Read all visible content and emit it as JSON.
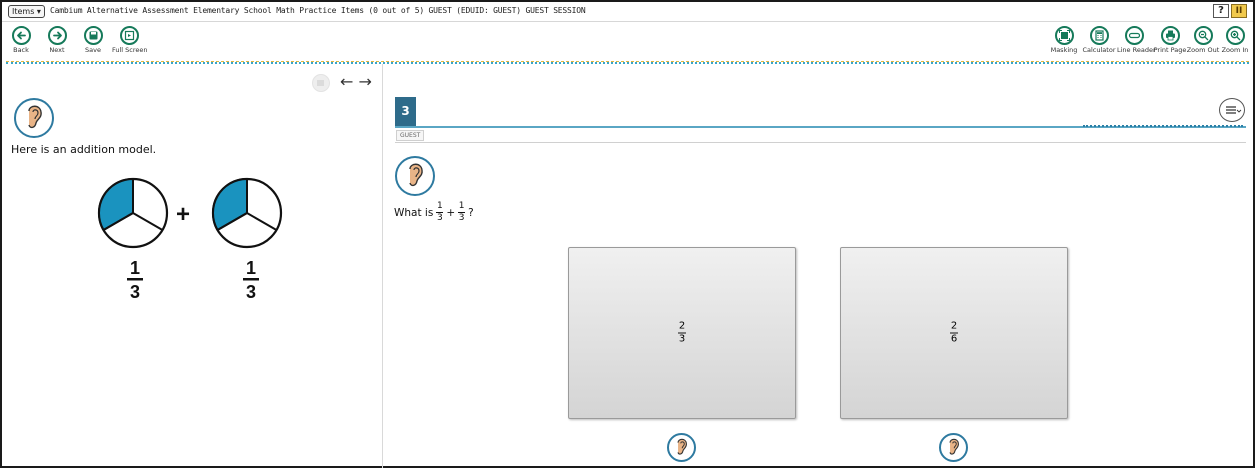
{
  "header": {
    "items_label": "Items ▾",
    "title": "Cambium Alternative Assessment Elementary School Math Practice Items (0 out of 5)   GUEST (EDUID: GUEST)   GUEST SESSION",
    "help_label": "?",
    "pause_label": "II"
  },
  "toolbar": {
    "left_tools": [
      {
        "label": "Back",
        "icon": "arrow-left-icon"
      },
      {
        "label": "Next",
        "icon": "arrow-right-icon"
      },
      {
        "label": "Save",
        "icon": "save-icon"
      },
      {
        "label": "Full Screen",
        "icon": "fullscreen-icon"
      }
    ],
    "right_tools": [
      {
        "label": "Masking",
        "icon": "masking-icon"
      },
      {
        "label": "Calculator",
        "icon": "calculator-icon"
      },
      {
        "label": "Line Reader",
        "icon": "line-reader-icon"
      },
      {
        "label": "Print Page",
        "icon": "print-icon"
      },
      {
        "label": "Zoom Out",
        "icon": "zoom-out-icon"
      },
      {
        "label": "Zoom In",
        "icon": "zoom-in-icon"
      }
    ],
    "accent_color": "#167a5a"
  },
  "stimulus": {
    "nav_arrows": "← →",
    "intro": "Here is an addition model.",
    "plus_sign": "+",
    "left_fraction": {
      "numerator": "1",
      "denominator": "3"
    },
    "right_fraction": {
      "numerator": "1",
      "denominator": "3"
    },
    "shaded_fraction": 0.3333,
    "shade_color": "#1a93bf"
  },
  "question": {
    "number": "3",
    "guest_tag": "GUEST",
    "prefix": "What is",
    "a": {
      "numerator": "1",
      "denominator": "3"
    },
    "operator": "+",
    "b": {
      "numerator": "1",
      "denominator": "3"
    },
    "suffix": "?",
    "answers": [
      {
        "numerator": "2",
        "denominator": "3"
      },
      {
        "numerator": "2",
        "denominator": "6"
      }
    ],
    "header_color": "#2e6b8a"
  }
}
